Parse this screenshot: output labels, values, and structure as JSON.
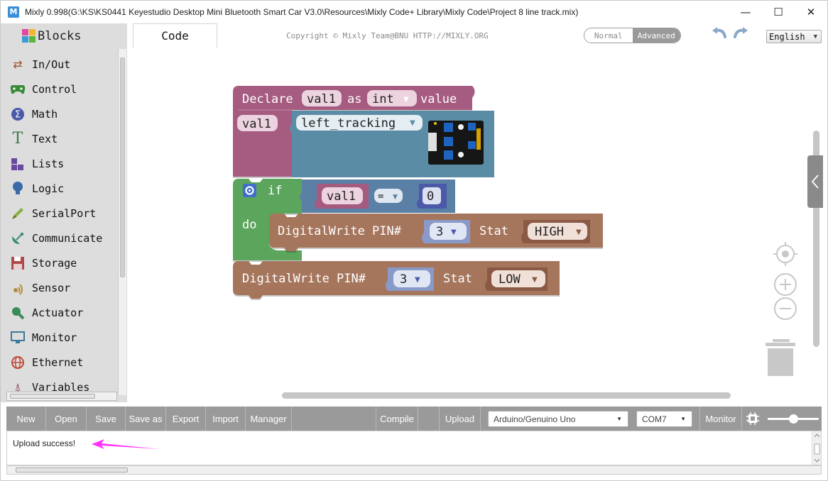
{
  "window": {
    "title": "Mixly 0.998(G:\\KS\\KS0441 Keyestudio Desktop Mini Bluetooth Smart Car V3.0\\Resources\\Mixly Code+ Library\\Mixly Code\\Project 8 line track.mix)",
    "app_icon_letter": "M",
    "minimize": "—",
    "maximize": "☐",
    "close": "✕"
  },
  "sidebar": {
    "tab_label": "Blocks",
    "categories": [
      {
        "label": "In/Out",
        "icon": "arrows-icon",
        "color": "#a0522d"
      },
      {
        "label": "Control",
        "icon": "gamepad-icon",
        "color": "#3a8a3a"
      },
      {
        "label": "Math",
        "icon": "sigma-icon",
        "color": "#4a5aa8"
      },
      {
        "label": "Text",
        "icon": "text-t-icon",
        "color": "#3a7a4a"
      },
      {
        "label": "Lists",
        "icon": "lists-icon",
        "color": "#6a4aa0"
      },
      {
        "label": "Logic",
        "icon": "bulb-icon",
        "color": "#3a6aa8"
      },
      {
        "label": "SerialPort",
        "icon": "pen-icon",
        "color": "#8ab040"
      },
      {
        "label": "Communicate",
        "icon": "satellite-icon",
        "color": "#3a8a7a"
      },
      {
        "label": "Storage",
        "icon": "floppy-icon",
        "color": "#b04a4a"
      },
      {
        "label": "Sensor",
        "icon": "signal-icon",
        "color": "#b08a3a"
      },
      {
        "label": "Actuator",
        "icon": "actuator-icon",
        "color": "#3a8a5a"
      },
      {
        "label": "Monitor",
        "icon": "monitor-icon",
        "color": "#3a7a9a"
      },
      {
        "label": "Ethernet",
        "icon": "globe-icon",
        "color": "#c04a3a"
      },
      {
        "label": "Variables",
        "icon": "variables-icon",
        "color": "#9a4a6a"
      }
    ]
  },
  "header": {
    "code_tab": "Code",
    "copyright": "Copyright © Mixly Team@BNU HTTP://MIXLY.ORG",
    "mode_normal": "Normal",
    "mode_advanced": "Advanced",
    "language": "English"
  },
  "blocks": {
    "declare": {
      "keyword": "Declare",
      "var": "val1",
      "as": "as",
      "type": "int",
      "value": "value"
    },
    "assign_var": "val1",
    "sensor": "left_tracking",
    "if": {
      "keyword": "if",
      "do": "do",
      "var": "val1",
      "op": "=",
      "num": "0"
    },
    "write_high": {
      "label": "DigitalWrite PIN#",
      "pin": "3",
      "stat": "Stat",
      "level": "HIGH"
    },
    "write_low": {
      "label": "DigitalWrite PIN#",
      "pin": "3",
      "stat": "Stat",
      "level": "LOW"
    }
  },
  "toolbar": {
    "new": "New",
    "open": "Open",
    "save": "Save",
    "save_as": "Save as",
    "export": "Export",
    "import": "Import",
    "manager": "Manager",
    "compile": "Compile",
    "upload": "Upload",
    "board": "Arduino/Genuino Uno",
    "port": "COM7",
    "monitor": "Monitor"
  },
  "output": {
    "message": "Upload success!"
  },
  "colors": {
    "declare_block": "#a55b80",
    "sensor_block": "#5b8ca5",
    "if_block": "#5ba55b",
    "compare_block": "#5b80a5",
    "digitalwrite_block": "#a5745b",
    "annotation_arrow": "#ff33ff"
  }
}
